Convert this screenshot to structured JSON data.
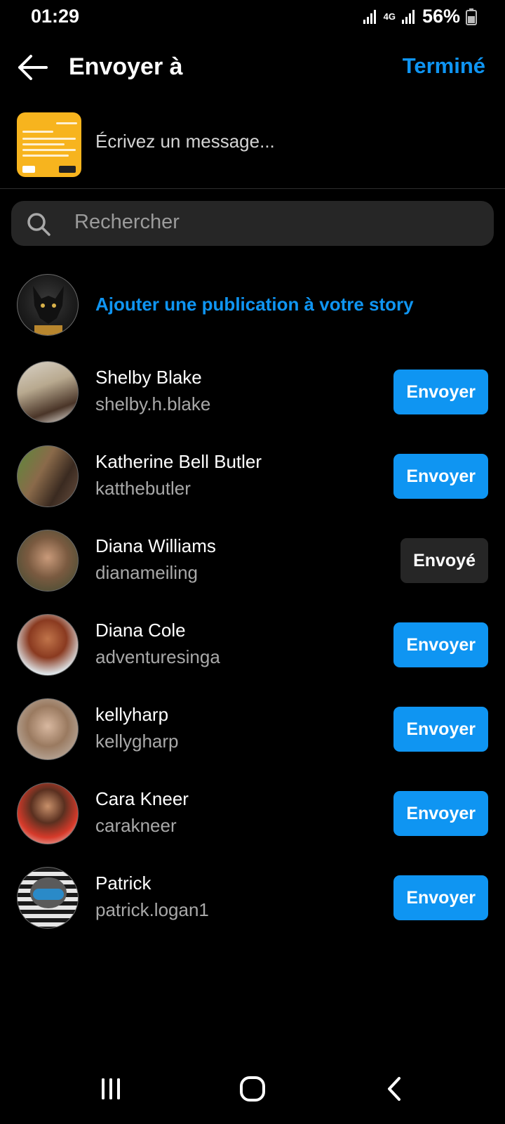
{
  "status_bar": {
    "time": "01:29",
    "network": "4G",
    "battery": "56%"
  },
  "header": {
    "title": "Envoyer à",
    "done_label": "Terminé"
  },
  "compose": {
    "placeholder": "Écrivez un message..."
  },
  "search": {
    "placeholder": "Rechercher"
  },
  "story": {
    "label": "Ajouter une publication à votre story"
  },
  "contacts": [
    {
      "name": "Shelby Blake",
      "username": "shelby.h.blake",
      "action": "Envoyer",
      "sent": false
    },
    {
      "name": "Katherine Bell Butler",
      "username": "katthebutler",
      "action": "Envoyer",
      "sent": false
    },
    {
      "name": "Diana Williams",
      "username": "dianameiling",
      "action": "Envoyé",
      "sent": true
    },
    {
      "name": "Diana Cole",
      "username": "adventuresinga",
      "action": "Envoyer",
      "sent": false
    },
    {
      "name": "kellyharp",
      "username": "kellygharp",
      "action": "Envoyer",
      "sent": false
    },
    {
      "name": "Cara Kneer",
      "username": "carakneer",
      "action": "Envoyer",
      "sent": false
    },
    {
      "name": "Patrick",
      "username": "patrick.logan1",
      "action": "Envoyer",
      "sent": false
    }
  ],
  "colors": {
    "accent": "#0f95f2",
    "background": "#000000",
    "field": "#262626",
    "secondary_text": "#a8a8a8"
  },
  "icons": {
    "back": "arrow-left-icon",
    "search": "search-icon",
    "recents": "recents-icon",
    "home": "home-icon",
    "nav_back": "chevron-left-icon"
  }
}
